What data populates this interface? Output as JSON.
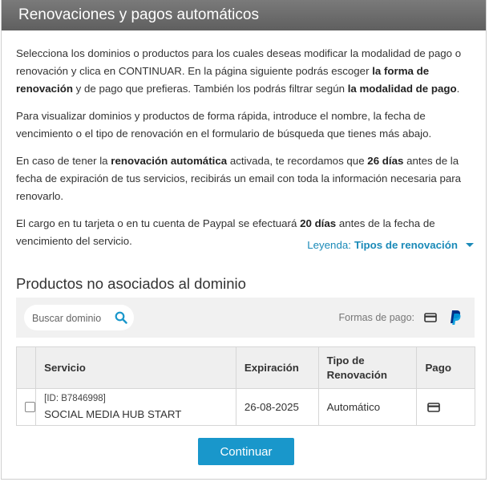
{
  "header": {
    "title": "Renovaciones y pagos automáticos"
  },
  "intro": {
    "p1_a": "Selecciona los dominios o productos para los cuales deseas modificar la modalidad de pago o renovación y clica en CONTINUAR. En la página siguiente podrás escoger ",
    "p1_b": "la forma de renovación",
    "p1_c": " y de pago que prefieras. También los podrás filtrar según ",
    "p1_d": "la modalidad de pago",
    "p1_e": ".",
    "p2": "Para visualizar dominios y productos de forma rápida, introduce el nombre, la fecha de vencimiento o el tipo de renovación en el formulario de búsqueda que tienes más abajo.",
    "p3_a": "En caso de tener la ",
    "p3_b": "renovación automática",
    "p3_c": " activada, te recordamos que ",
    "p3_d": "26 días",
    "p3_e": " antes de la fecha de expiración de tus servicios, recibirás un email con toda la información necesaria para renovarlo.",
    "p4_a": "El cargo en tu tarjeta o en tu cuenta de Paypal se efectuará ",
    "p4_b": "20 días",
    "p4_c": " antes de la fecha de vencimiento del servicio."
  },
  "legend": {
    "label": "Leyenda:",
    "link": "Tipos de renovación"
  },
  "section": {
    "title": "Productos no asociados al dominio"
  },
  "filter": {
    "search_placeholder": "Buscar dominio",
    "payment_label": "Formas de pago:"
  },
  "table": {
    "headers": {
      "servicio": "Servicio",
      "expiracion": "Expiración",
      "tipo": "Tipo de Renovación",
      "pago": "Pago"
    },
    "rows": [
      {
        "id": "[ID: B7846998]",
        "name": "SOCIAL MEDIA HUB START",
        "expiracion": "26-08-2025",
        "tipo": "Automático"
      }
    ]
  },
  "actions": {
    "continue_label": "Continuar"
  },
  "colors": {
    "accent": "#1997cb",
    "link": "#1a8ab8",
    "header_bg": "#6b6b6b",
    "paypal_dark": "#003087",
    "paypal_light": "#009cde"
  }
}
